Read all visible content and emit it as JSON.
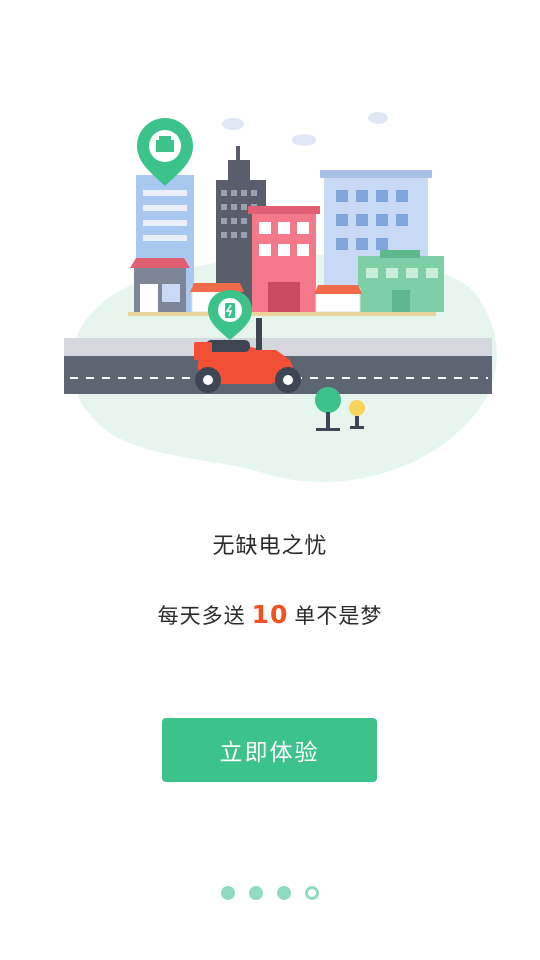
{
  "onboarding": {
    "title": "无缺电之忧",
    "subtitle_prefix": "每天多送",
    "subtitle_number": "10",
    "subtitle_suffix": "单不是梦",
    "cta_label": "立即体验",
    "page_indicator": {
      "total": 4,
      "active": 4
    }
  },
  "colors": {
    "accent": "#3cc38b",
    "highlight": "#f4511e",
    "dot": "#8fdcc0"
  }
}
